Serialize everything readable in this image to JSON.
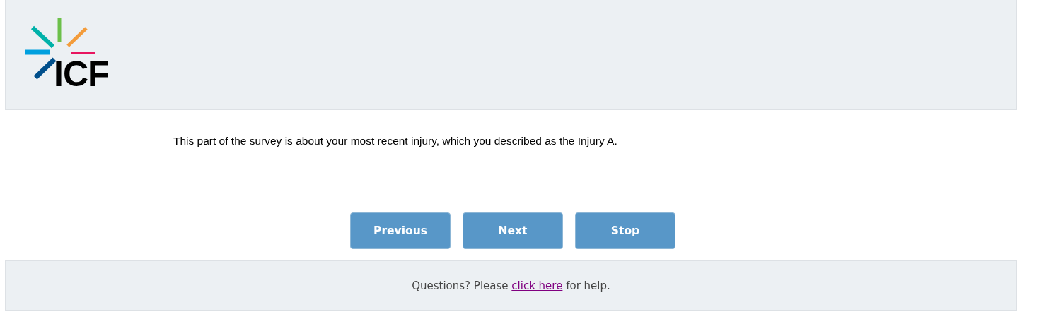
{
  "header": {
    "logo_text": "ICF"
  },
  "intro": "This part of the survey is about your most recent injury, which you described as the Injury A.",
  "buttons": [
    {
      "label": "Previous"
    },
    {
      "label": "Next"
    },
    {
      "label": "Stop"
    }
  ],
  "footer": {
    "before": "Questions? Please",
    "link": "click here",
    "after": "for help."
  }
}
